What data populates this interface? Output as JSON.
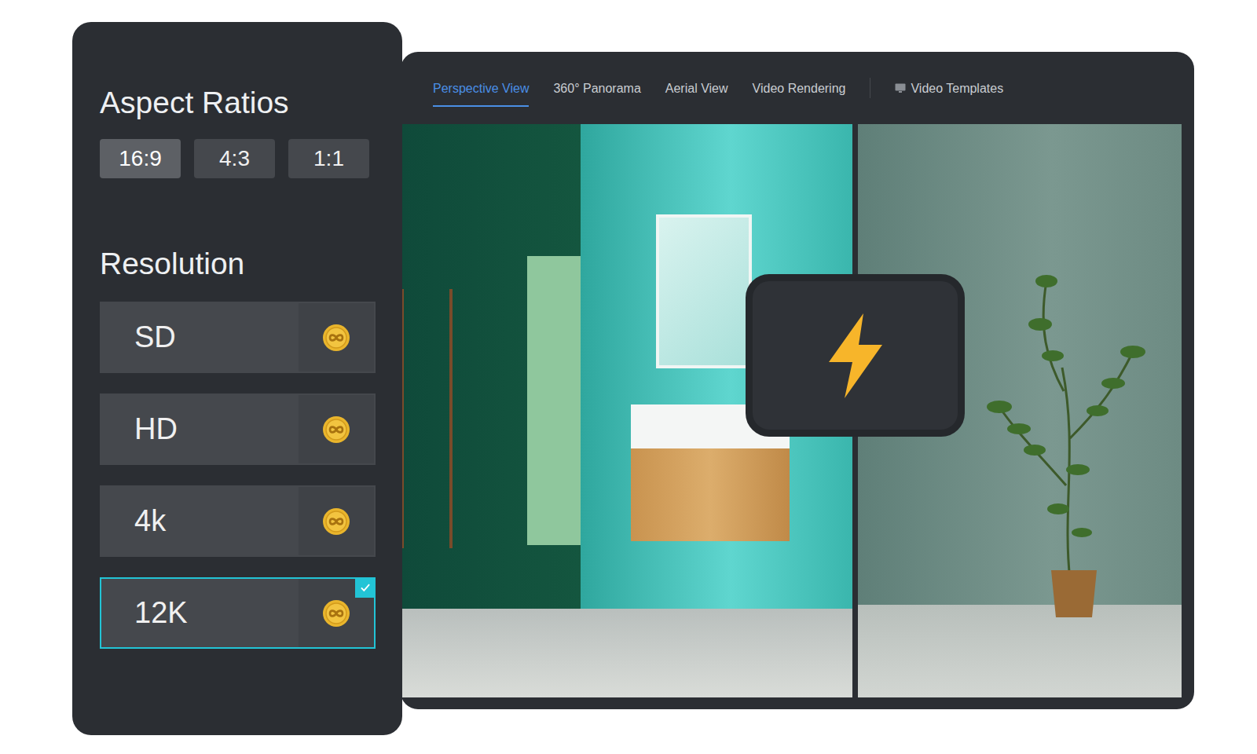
{
  "aspect_ratios": {
    "title": "Aspect Ratios",
    "options": [
      {
        "label": "16:9",
        "selected": true
      },
      {
        "label": "4:3",
        "selected": false
      },
      {
        "label": "1:1",
        "selected": false
      }
    ]
  },
  "resolution": {
    "title": "Resolution",
    "options": [
      {
        "label": "SD",
        "selected": false
      },
      {
        "label": "HD",
        "selected": false
      },
      {
        "label": "4k",
        "selected": false
      },
      {
        "label": "12K",
        "selected": true
      }
    ]
  },
  "tabs": [
    {
      "label": "Perspective View",
      "selected": true
    },
    {
      "label": "360° Panorama",
      "selected": false
    },
    {
      "label": "Aerial View",
      "selected": false
    },
    {
      "label": "Video Rendering",
      "selected": false
    }
  ],
  "templates_link": {
    "label": "Video Templates"
  }
}
